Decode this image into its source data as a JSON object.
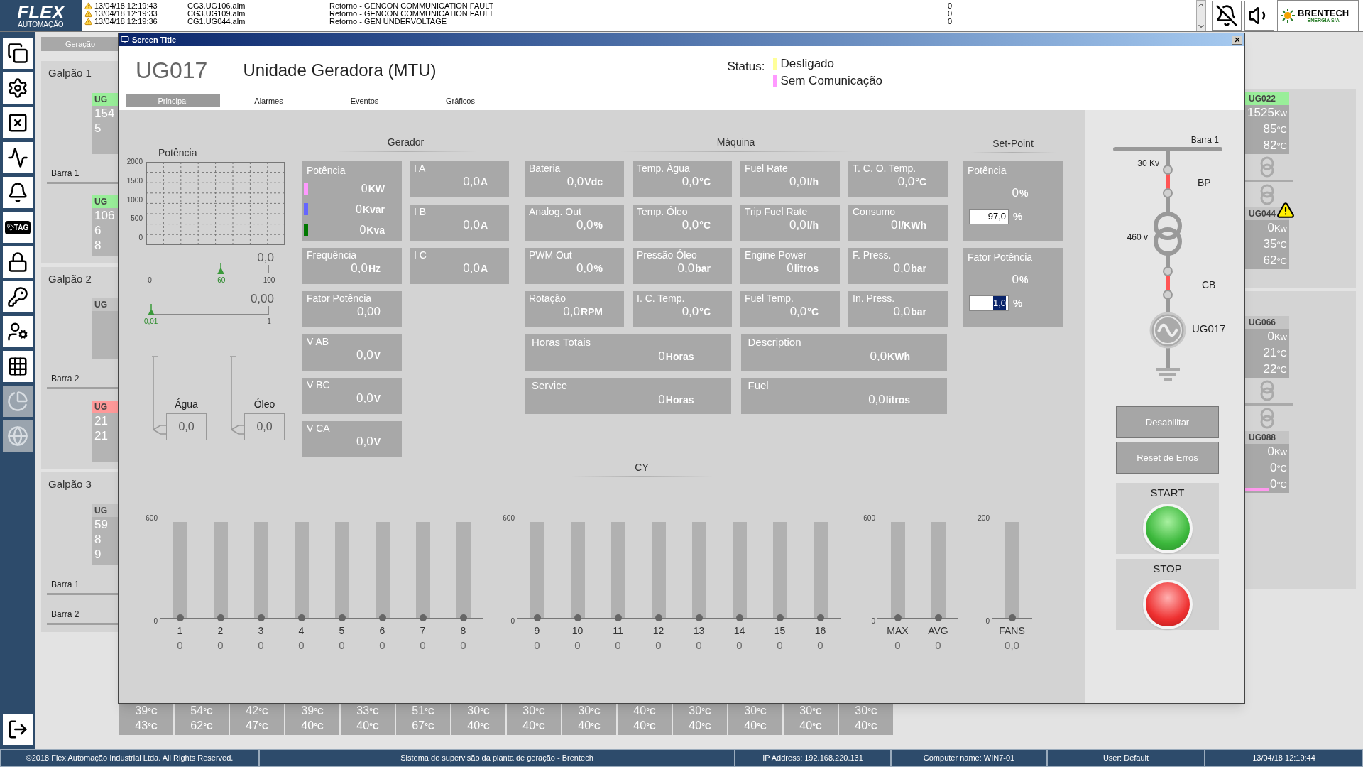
{
  "top_bar": {
    "logo": {
      "name": "FLEX",
      "subtitle": "AUTOMAÇÃO"
    },
    "alarms": [
      {
        "time": "13/04/18 12:19:43",
        "file": "CG3.UG106.alm",
        "message": "Retorno - GENCON COMMUNICATION FAULT",
        "value": "0"
      },
      {
        "time": "13/04/18 12:19:33",
        "file": "CG3.UG109.alm",
        "message": "Retorno - GENCON COMMUNICATION FAULT",
        "value": "0"
      },
      {
        "time": "13/04/18 12:19:36",
        "file": "CG1.UG044.alm",
        "message": "Retorno - GEN UNDERVOLTAGE",
        "value": "0"
      }
    ],
    "brand": {
      "name": "BRENTECH",
      "subtitle": "ENERGIA S/A"
    }
  },
  "toolbar": [
    {
      "kind": "windows",
      "disabled": false
    },
    {
      "kind": "settings",
      "disabled": false
    },
    {
      "kind": "excel",
      "disabled": false
    },
    {
      "kind": "chart",
      "disabled": false
    },
    {
      "kind": "alarm",
      "disabled": false
    },
    {
      "kind": "tag",
      "label": "TAG",
      "disabled": false
    },
    {
      "kind": "lock",
      "disabled": false
    },
    {
      "kind": "key",
      "disabled": false
    },
    {
      "kind": "user",
      "disabled": false
    },
    {
      "kind": "calculator",
      "disabled": false
    },
    {
      "kind": "pie",
      "disabled": true
    },
    {
      "kind": "globe",
      "disabled": true
    }
  ],
  "overview": {
    "tab": "Geração",
    "left_groups": [
      {
        "title": "Galpão 1",
        "items": [
          {
            "kind": "unit",
            "header": "UG",
            "color": "#99ee99",
            "lines": [
              "154",
              "5"
            ]
          },
          {
            "kind": "bus",
            "label": "Barra 1"
          },
          {
            "kind": "unit",
            "header": "UG",
            "color": "#99ee99",
            "lines": [
              "106",
              "6",
              "8"
            ]
          }
        ]
      },
      {
        "title": "Galpão 2",
        "items": [
          {
            "kind": "unit",
            "header": "UG",
            "color": "#c4c4c4"
          },
          {
            "kind": "bus",
            "label": "Barra 2"
          },
          {
            "kind": "unit",
            "header": "UG",
            "color": "#ff9999",
            "lines": [
              "21",
              "21"
            ]
          }
        ]
      },
      {
        "title": "Galpão 3",
        "items": [
          {
            "kind": "unit",
            "header": "UG",
            "color": "#c4c4c4",
            "lines": [
              "59",
              "8",
              "9"
            ]
          },
          {
            "kind": "bus",
            "label": "Barra 1"
          },
          {
            "kind": "bus",
            "label": "Barra 2"
          }
        ]
      }
    ],
    "right_groups": [
      {
        "items": [
          {
            "kind": "unit",
            "header": "UG022",
            "color": "#99ee99",
            "warning": false,
            "lines": [
              {
                "value": "1525",
                "unit": "Kw"
              },
              {
                "value": "85",
                "unit": "°C"
              },
              {
                "value": "82",
                "unit": "°C"
              }
            ]
          },
          {
            "kind": "bus"
          },
          {
            "kind": "unit",
            "header": "UG044",
            "color": "#c4c4c4",
            "warning": true,
            "lines": [
              {
                "value": "0",
                "unit": "Kw"
              },
              {
                "value": "35",
                "unit": "°C"
              },
              {
                "value": "62",
                "unit": "°C"
              }
            ]
          }
        ]
      },
      {
        "items": [
          {
            "kind": "unit",
            "header": "UG066",
            "color": "#c4c4c4",
            "warning": false,
            "lines": [
              {
                "value": "0",
                "unit": "Kw"
              },
              {
                "value": "21",
                "unit": "°C"
              },
              {
                "value": "22",
                "unit": "°C"
              }
            ]
          },
          {
            "kind": "bus"
          },
          {
            "kind": "unit",
            "header": "UG088",
            "color": "#c4c4c4",
            "warning": false,
            "flag": {
              "color": "#ff99ee"
            },
            "lines": [
              {
                "value": "0",
                "unit": "Kw"
              },
              {
                "value": "0",
                "unit": "°C"
              },
              {
                "value": "0",
                "unit": "°C"
              }
            ]
          }
        ]
      }
    ],
    "temperature_cells": [
      {
        "upper": "39",
        "upper_unit": "°C",
        "lower": "43",
        "lower_unit": "°C"
      },
      {
        "upper": "54",
        "upper_unit": "°C",
        "lower": "62",
        "lower_unit": "°C"
      },
      {
        "upper": "42",
        "upper_unit": "°C",
        "lower": "47",
        "lower_unit": "°C"
      },
      {
        "upper": "39",
        "upper_unit": "°C",
        "lower": "40",
        "lower_unit": "°C"
      },
      {
        "upper": "33",
        "upper_unit": "°C",
        "lower": "40",
        "lower_unit": "°C"
      },
      {
        "upper": "51",
        "upper_unit": "°C",
        "lower": "67",
        "lower_unit": "°C"
      },
      {
        "upper": "30",
        "upper_unit": "°C",
        "lower": "40",
        "lower_unit": "°C"
      },
      {
        "upper": "30",
        "upper_unit": "°C",
        "lower": "40",
        "lower_unit": "°C"
      },
      {
        "upper": "30",
        "upper_unit": "°C",
        "lower": "40",
        "lower_unit": "°C"
      },
      {
        "upper": "40",
        "upper_unit": "°C",
        "lower": "40",
        "lower_unit": "°C"
      },
      {
        "upper": "30",
        "upper_unit": "°C",
        "lower": "40",
        "lower_unit": "°C"
      },
      {
        "upper": "30",
        "upper_unit": "°C",
        "lower": "40",
        "lower_unit": "°C"
      },
      {
        "upper": "30",
        "upper_unit": "°C",
        "lower": "40",
        "lower_unit": "°C"
      },
      {
        "upper": "30",
        "upper_unit": "°C",
        "lower": "40",
        "lower_unit": "°C"
      }
    ]
  },
  "dialog": {
    "title": "Screen Title",
    "unit": "UG017",
    "name": "Unidade Geradora (MTU)",
    "status_label": "Status:",
    "status": [
      {
        "text": "Desligado",
        "color": "#ffff99"
      },
      {
        "text": "Sem Comunicação",
        "color": "#ff99ff"
      }
    ],
    "tabs": [
      {
        "label": "Principal",
        "selected": true
      },
      {
        "label": "Alarmes",
        "selected": false
      },
      {
        "label": "Eventos",
        "selected": false
      },
      {
        "label": "Gráficos",
        "selected": false
      }
    ],
    "potencia": {
      "title": "Potência",
      "y_ticks": [
        "2000",
        "1500",
        "1000",
        "500",
        "0"
      ],
      "sliders": [
        {
          "reading": "0,0",
          "min_label": "0",
          "max_label": "100",
          "marker_label": "60",
          "level": 0.6
        },
        {
          "reading": "0,00",
          "max_label": "1",
          "marker_label": "0,01",
          "level": 0.01
        }
      ],
      "gauges": [
        {
          "label": "Água",
          "value": "0,0"
        },
        {
          "label": "Óleo",
          "value": "0,0"
        }
      ]
    },
    "gerador": {
      "title": "Gerador",
      "columns": [
        [
          {
            "kind": "multi",
            "label": "Potência",
            "rows": [
              {
                "value": "0",
                "unit": "KW",
                "color": "#ff99ff"
              },
              {
                "value": "0",
                "unit": "Kvar",
                "color": "#6666ff"
              },
              {
                "value": "0",
                "unit": "Kva",
                "color": "#007700"
              }
            ]
          },
          {
            "kind": "single",
            "label": "Frequência",
            "value": "0,0",
            "unit": "Hz"
          },
          {
            "kind": "single",
            "label": "Fator Potência",
            "value": "0,00"
          },
          {
            "kind": "single",
            "label": "V AB",
            "value": "0,0",
            "unit": "V"
          },
          {
            "kind": "single",
            "label": "V BC",
            "value": "0,0",
            "unit": "V"
          },
          {
            "kind": "single",
            "label": "V CA",
            "value": "0,0",
            "unit": "V"
          }
        ],
        [
          {
            "kind": "single",
            "label": "I A",
            "value": "0,0",
            "unit": "A"
          },
          {
            "kind": "single",
            "label": "I B",
            "value": "0,0",
            "unit": "A"
          },
          {
            "kind": "single",
            "label": "I C",
            "value": "0,0",
            "unit": "A"
          }
        ]
      ]
    },
    "maquina": {
      "title": "Máquina",
      "cards": [
        {
          "label": "Bateria",
          "value": "0,0",
          "unit": "Vdc"
        },
        {
          "label": "Temp. Água",
          "value": "0,0",
          "unit": "°C"
        },
        {
          "label": "Fuel Rate",
          "value": "0,0",
          "unit": "l/h"
        },
        {
          "label": "T. C. O. Temp.",
          "value": "0,0",
          "unit": "°C"
        },
        {
          "label": "Analog. Out",
          "value": "0,0",
          "unit": "%"
        },
        {
          "label": "Temp. Óleo",
          "value": "0,0",
          "unit": "°C"
        },
        {
          "label": "Trip Fuel Rate",
          "value": "0,0",
          "unit": "l/h"
        },
        {
          "label": "Consumo",
          "value": "0",
          "unit": "l/KWh"
        },
        {
          "label": "PWM Out",
          "value": "0,0",
          "unit": "%"
        },
        {
          "label": "Pressão Óleo",
          "value": "0,0",
          "unit": "bar"
        },
        {
          "label": "Engine Power",
          "value": "0",
          "unit": "litros"
        },
        {
          "label": "F. Press.",
          "value": "0,0",
          "unit": "bar"
        },
        {
          "label": "Rotação",
          "value": "0,0",
          "unit": "RPM"
        },
        {
          "label": "I. C. Temp.",
          "value": "0,0",
          "unit": "°C"
        },
        {
          "label": "Fuel Temp.",
          "value": "0,0",
          "unit": "°C"
        },
        {
          "label": "In. Press.",
          "value": "0,0",
          "unit": "bar"
        }
      ],
      "wide_cards": [
        {
          "label": "Horas Totais",
          "value": "0",
          "unit": "Horas"
        },
        {
          "label": "Description",
          "value": "0,0",
          "unit": "KWh"
        },
        {
          "label": "Service",
          "value": "0",
          "unit": "Horas"
        },
        {
          "label": "Fuel",
          "value": "0,0",
          "unit": "litros"
        }
      ]
    },
    "set_point": {
      "title": "Set-Point",
      "cards": [
        {
          "label": "Potência",
          "reading": "0",
          "reading_unit": "%",
          "input": "97,0",
          "input_selected": false,
          "input_unit": "%"
        },
        {
          "label": "Fator Potência",
          "reading": "0",
          "reading_unit": "%",
          "input": "1,0",
          "input_selected": true,
          "input_unit": "%"
        }
      ]
    },
    "cy": {
      "title": "CY",
      "groups": [
        {
          "y_ticks": [
            "600",
            "0"
          ],
          "bars": [
            {
              "label": "1",
              "value": "0",
              "level": 0
            },
            {
              "label": "2",
              "value": "0",
              "level": 0
            },
            {
              "label": "3",
              "value": "0",
              "level": 0
            },
            {
              "label": "4",
              "value": "0",
              "level": 0
            },
            {
              "label": "5",
              "value": "0",
              "level": 0
            },
            {
              "label": "6",
              "value": "0",
              "level": 0
            },
            {
              "label": "7",
              "value": "0",
              "level": 0
            },
            {
              "label": "8",
              "value": "0",
              "level": 0
            }
          ]
        },
        {
          "y_ticks": [
            "600",
            "0"
          ],
          "bars": [
            {
              "label": "9",
              "value": "0",
              "level": 0
            },
            {
              "label": "10",
              "value": "0",
              "level": 0
            },
            {
              "label": "11",
              "value": "0",
              "level": 0
            },
            {
              "label": "12",
              "value": "0",
              "level": 0
            },
            {
              "label": "13",
              "value": "0",
              "level": 0
            },
            {
              "label": "14",
              "value": "0",
              "level": 0
            },
            {
              "label": "15",
              "value": "0",
              "level": 0
            },
            {
              "label": "16",
              "value": "0",
              "level": 0
            }
          ]
        },
        {
          "y_ticks": [
            "600",
            "0"
          ],
          "bars": [
            {
              "label": "MAX",
              "value": "0",
              "level": 0
            },
            {
              "label": "AVG",
              "value": "0",
              "level": 0
            }
          ]
        },
        {
          "y_ticks": [
            "200",
            "0"
          ],
          "bars": [
            {
              "label": "FANS",
              "value": "0,0",
              "level": 0
            }
          ]
        }
      ]
    },
    "diagram": {
      "bus": "Barra 1",
      "voltage_high": "30 Kv",
      "voltage_low": "460 v",
      "breakers": [
        {
          "label": "BP",
          "closed": true
        },
        {
          "label": "CB",
          "closed": true
        }
      ],
      "generator": "UG017"
    },
    "buttons": [
      "Desabilitar",
      "Reset de Erros"
    ],
    "commands": [
      {
        "kind": "start",
        "label": "START"
      },
      {
        "kind": "stop",
        "label": "STOP"
      }
    ]
  },
  "status_bar": [
    "©2018 Flex Automação Industrial Ltda. All Rights Reserved.",
    "Sistema de supervisão da planta de geração - Brentech",
    "IP Address: 192.168.220.131",
    "Computer name: WIN7-01",
    "User: Default",
    "13/04/18 12:19:44"
  ]
}
